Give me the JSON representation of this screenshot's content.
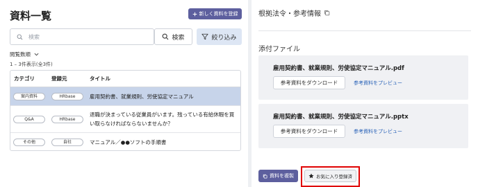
{
  "colors": {
    "accent": "#5d5f9e",
    "selected_row": "#c7d4ea",
    "filter_bg": "#dde6f4",
    "link": "#2a63b8",
    "highlight_box": "#e00000"
  },
  "left": {
    "title": "資料一覧",
    "new_button": "新しく資料を登録",
    "search_placeholder": "検索",
    "search_button": "検索",
    "filter_button": "絞り込み",
    "sort_label": "閲覧数順",
    "count_label": "1 – 3件表示(全3件)",
    "table": {
      "headers": [
        "カテゴリ",
        "登録元",
        "タイトル"
      ],
      "rows": [
        {
          "category": "案内資料",
          "registrant": "HRbase",
          "title": "雇用契約書、就業規則、労使協定マニュアル"
        },
        {
          "category": "Q&A",
          "registrant": "HRbase",
          "title": "退職が決まっている従業員がいます。残っている有給休暇を買い取らなければならないませんか？"
        },
        {
          "category": "その他",
          "registrant": "自社",
          "title": "マニュアル／●●ソフトの手順書"
        }
      ]
    }
  },
  "right": {
    "title": "根拠法令・参考情報",
    "attachments_title": "添付ファイル",
    "files": [
      {
        "name": "雇用契約書、就業規則、労使協定マニュアル.pdf",
        "download": "参考資料をダウンロード",
        "preview": "参考資料をプレビュー"
      },
      {
        "name": "雇用契約書、就業規則、労使協定マニュアル.pptx",
        "download": "参考資料をダウンロード",
        "preview": "参考資料をプレビュー"
      }
    ],
    "copy_button": "資料を複製",
    "favorite_button": "お気に入り登録済"
  },
  "icons": [
    "plus-icon",
    "search-icon",
    "filter-icon",
    "chevron-down-icon",
    "copy-icon",
    "star-icon"
  ]
}
